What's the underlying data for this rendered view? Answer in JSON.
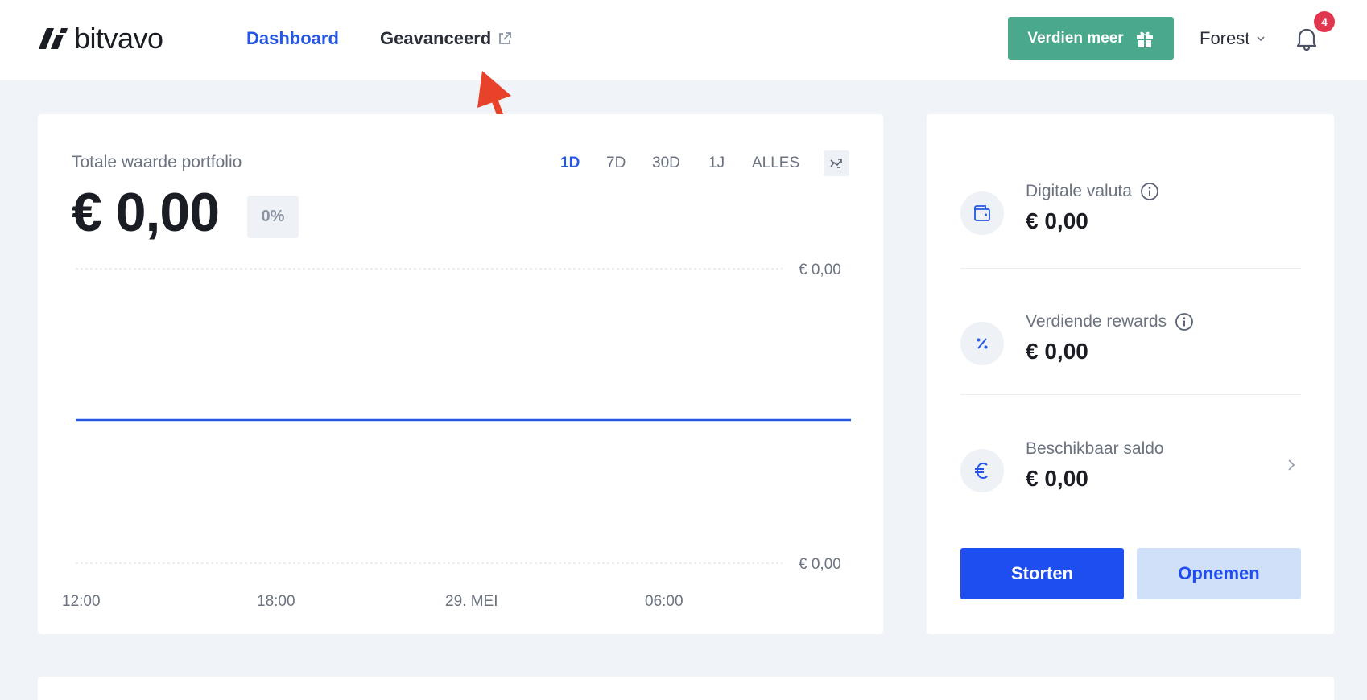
{
  "header": {
    "brand": "bitvavo",
    "nav": {
      "dashboard": "Dashboard",
      "advanced": "Geavanceerd"
    },
    "earn_button": "Verdien meer",
    "user": "Forest",
    "notifications_count": "4"
  },
  "portfolio": {
    "label": "Totale waarde portfolio",
    "value": "€ 0,00",
    "change": "0%",
    "periods": [
      "1D",
      "7D",
      "30D",
      "1J",
      "ALLES"
    ],
    "active_period": "1D"
  },
  "chart_data": {
    "type": "line",
    "x_tick_labels": [
      "12:00",
      "18:00",
      "29. MEI",
      "06:00"
    ],
    "y_tick_labels": [
      "€ 0,00",
      "€ 0,00"
    ],
    "series": [
      {
        "values": [
          0,
          0,
          0,
          0
        ]
      }
    ],
    "line_color": "#2557e6",
    "grid": true
  },
  "summary": {
    "items": [
      {
        "label": "Digitale valuta",
        "value": "€ 0,00",
        "icon": "wallet-icon",
        "info": true
      },
      {
        "label": "Verdiende rewards",
        "value": "€ 0,00",
        "icon": "percent-icon",
        "info": true
      },
      {
        "label": "Beschikbaar saldo",
        "value": "€ 0,00",
        "icon": "euro-icon",
        "info": false
      }
    ],
    "deposit": "Storten",
    "withdraw": "Opnemen"
  },
  "colors": {
    "accent": "#2557e6",
    "earn": "#4aa88c",
    "badge": "#e0364e",
    "annotation": "#e8432a"
  }
}
